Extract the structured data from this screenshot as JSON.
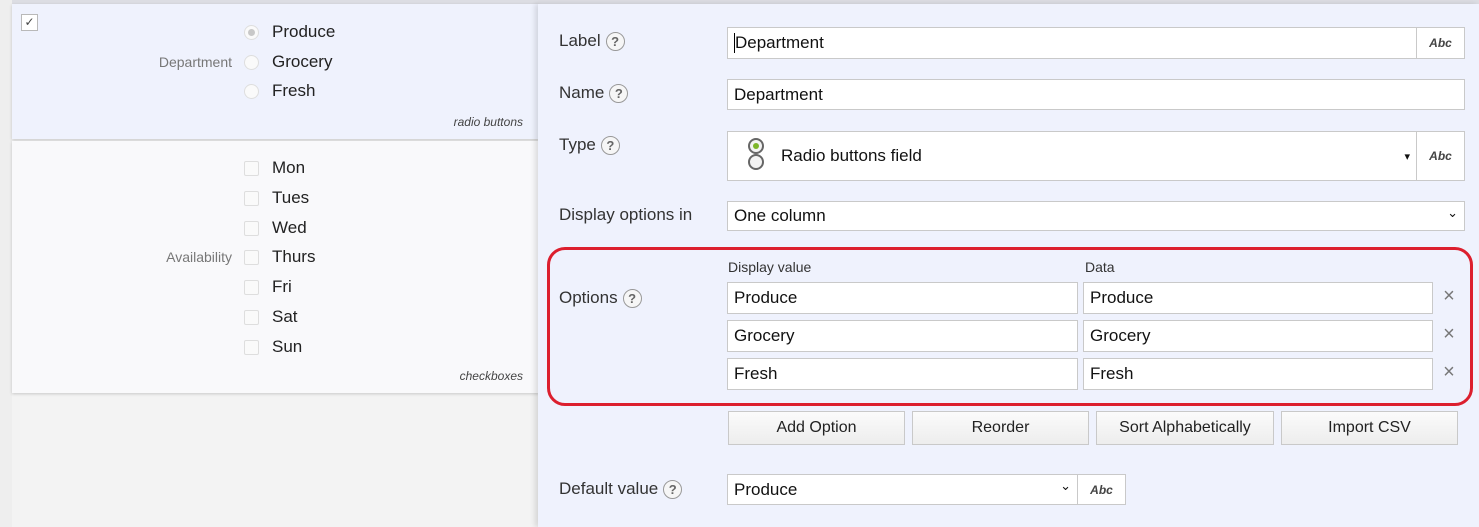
{
  "preview": {
    "radio_field": {
      "selected": true,
      "label": "Department",
      "options": [
        {
          "label": "Produce",
          "checked": true
        },
        {
          "label": "Grocery",
          "checked": false
        },
        {
          "label": "Fresh",
          "checked": false
        }
      ],
      "kind": "radio buttons"
    },
    "checkbox_field": {
      "label": "Availability",
      "options": [
        {
          "label": "Mon",
          "checked": false
        },
        {
          "label": "Tues",
          "checked": false
        },
        {
          "label": "Wed",
          "checked": false
        },
        {
          "label": "Thurs",
          "checked": false
        },
        {
          "label": "Fri",
          "checked": false
        },
        {
          "label": "Sat",
          "checked": false
        },
        {
          "label": "Sun",
          "checked": false
        }
      ],
      "kind": "checkboxes"
    }
  },
  "editor": {
    "label": {
      "caption": "Label",
      "value": "Department",
      "abc": "Abc"
    },
    "name": {
      "caption": "Name",
      "value": "Department"
    },
    "type": {
      "caption": "Type",
      "value": "Radio buttons field",
      "abc": "Abc"
    },
    "display_options": {
      "caption": "Display options in",
      "value": "One column"
    },
    "options": {
      "caption": "Options",
      "col_display": "Display value",
      "col_data": "Data",
      "rows": [
        {
          "display": "Produce",
          "data": "Produce"
        },
        {
          "display": "Grocery",
          "data": "Grocery"
        },
        {
          "display": "Fresh",
          "data": "Fresh"
        }
      ],
      "highlight_color": "#dc1f2e"
    },
    "buttons": {
      "add": "Add Option",
      "reorder": "Reorder",
      "sort": "Sort Alphabetically",
      "import": "Import CSV"
    },
    "default_value": {
      "caption": "Default value",
      "value": "Produce",
      "abc": "Abc"
    },
    "help_glyph": "?",
    "remove_glyph": "×",
    "chevron_glyph": "⌄",
    "small_arrow_glyph": "▾",
    "check_glyph": "✓"
  }
}
